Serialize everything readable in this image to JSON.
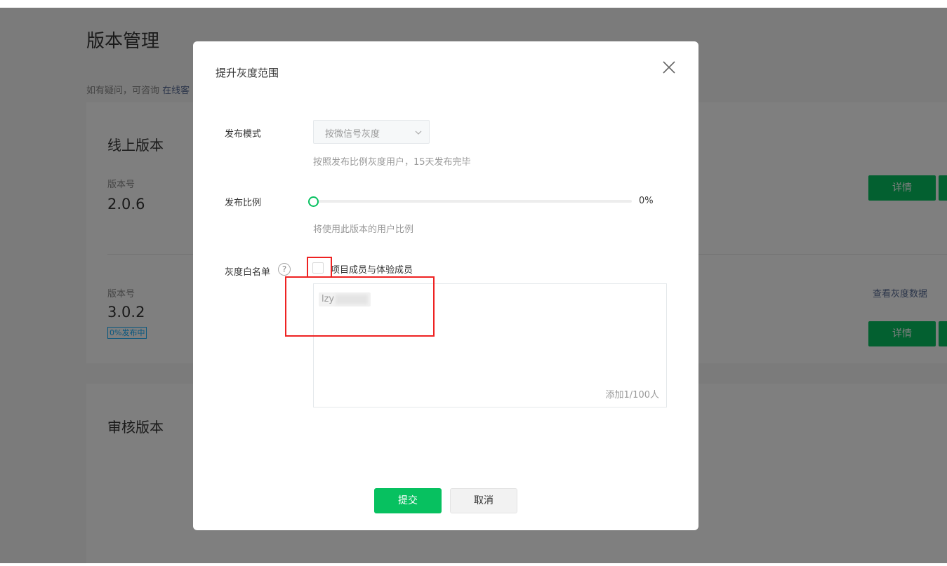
{
  "page": {
    "title": "版本管理",
    "help_prefix": "如有疑问，可咨询",
    "help_link": "在线客",
    "online_section": {
      "title": "线上版本",
      "v1_label": "版本号",
      "v1_number": "2.0.6",
      "v1_details": "详情",
      "v2_label": "版本号",
      "v2_number": "3.0.2",
      "v2_tag": "0%发布中",
      "v2_view_gray": "查看灰度数据",
      "v2_details": "详情"
    },
    "review_section": {
      "title": "审核版本"
    }
  },
  "dialog": {
    "title": "提升灰度范围",
    "release_mode": {
      "label": "发布模式",
      "value": "按微信号灰度",
      "desc": "按照发布比例灰度用户，15天发布完毕"
    },
    "release_ratio": {
      "label": "发布比例",
      "value_text": "0%",
      "percent": 0,
      "desc": "将使用此版本的用户比例"
    },
    "whitelist": {
      "label": "灰度白名单",
      "help": "?",
      "checkbox_label": "项目成员与体验成员",
      "checked": false,
      "member": "lzy",
      "counter": "添加1/100人"
    },
    "buttons": {
      "submit": "提交",
      "cancel": "取消"
    }
  },
  "colors": {
    "brand_green": "#07c160",
    "annotation_red": "#ee2222",
    "link": "#576b95"
  }
}
